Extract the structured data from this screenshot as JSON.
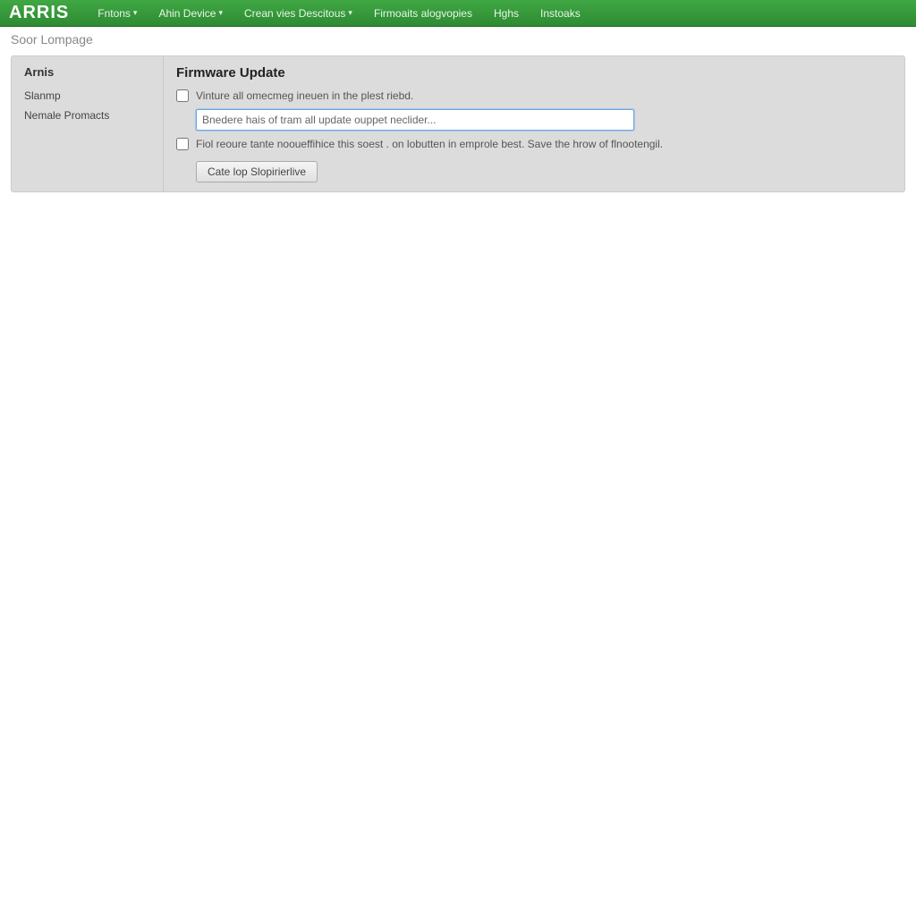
{
  "brand": "ARRIS",
  "nav": {
    "items": [
      {
        "label": "Fntons",
        "caret": true
      },
      {
        "label": "Ahin Device",
        "caret": true
      },
      {
        "label": "Crean vies Descitous",
        "caret": true
      },
      {
        "label": "Firmoaits alogvopies",
        "caret": false
      },
      {
        "label": "Hghs",
        "caret": false
      },
      {
        "label": "Instoaks",
        "caret": false
      }
    ]
  },
  "breadcrumb": "Soor Lompage",
  "sidebar": {
    "title": "Arnis",
    "items": [
      {
        "label": "Slanmp"
      },
      {
        "label": "Nemale Promacts"
      }
    ]
  },
  "main": {
    "title": "Firmware Update",
    "checkbox1_label": "Vinture all omecmeg ineuen in the plest riebd.",
    "input_value": "Bnedere hais of tram all update ouppet neclider...",
    "checkbox2_label": "Fiol reoure tante nooueffihice this soest . on lobutten in emprole best. Save the hrow of flnootengil.",
    "button_label": "Cate lop Slopirierlive"
  }
}
